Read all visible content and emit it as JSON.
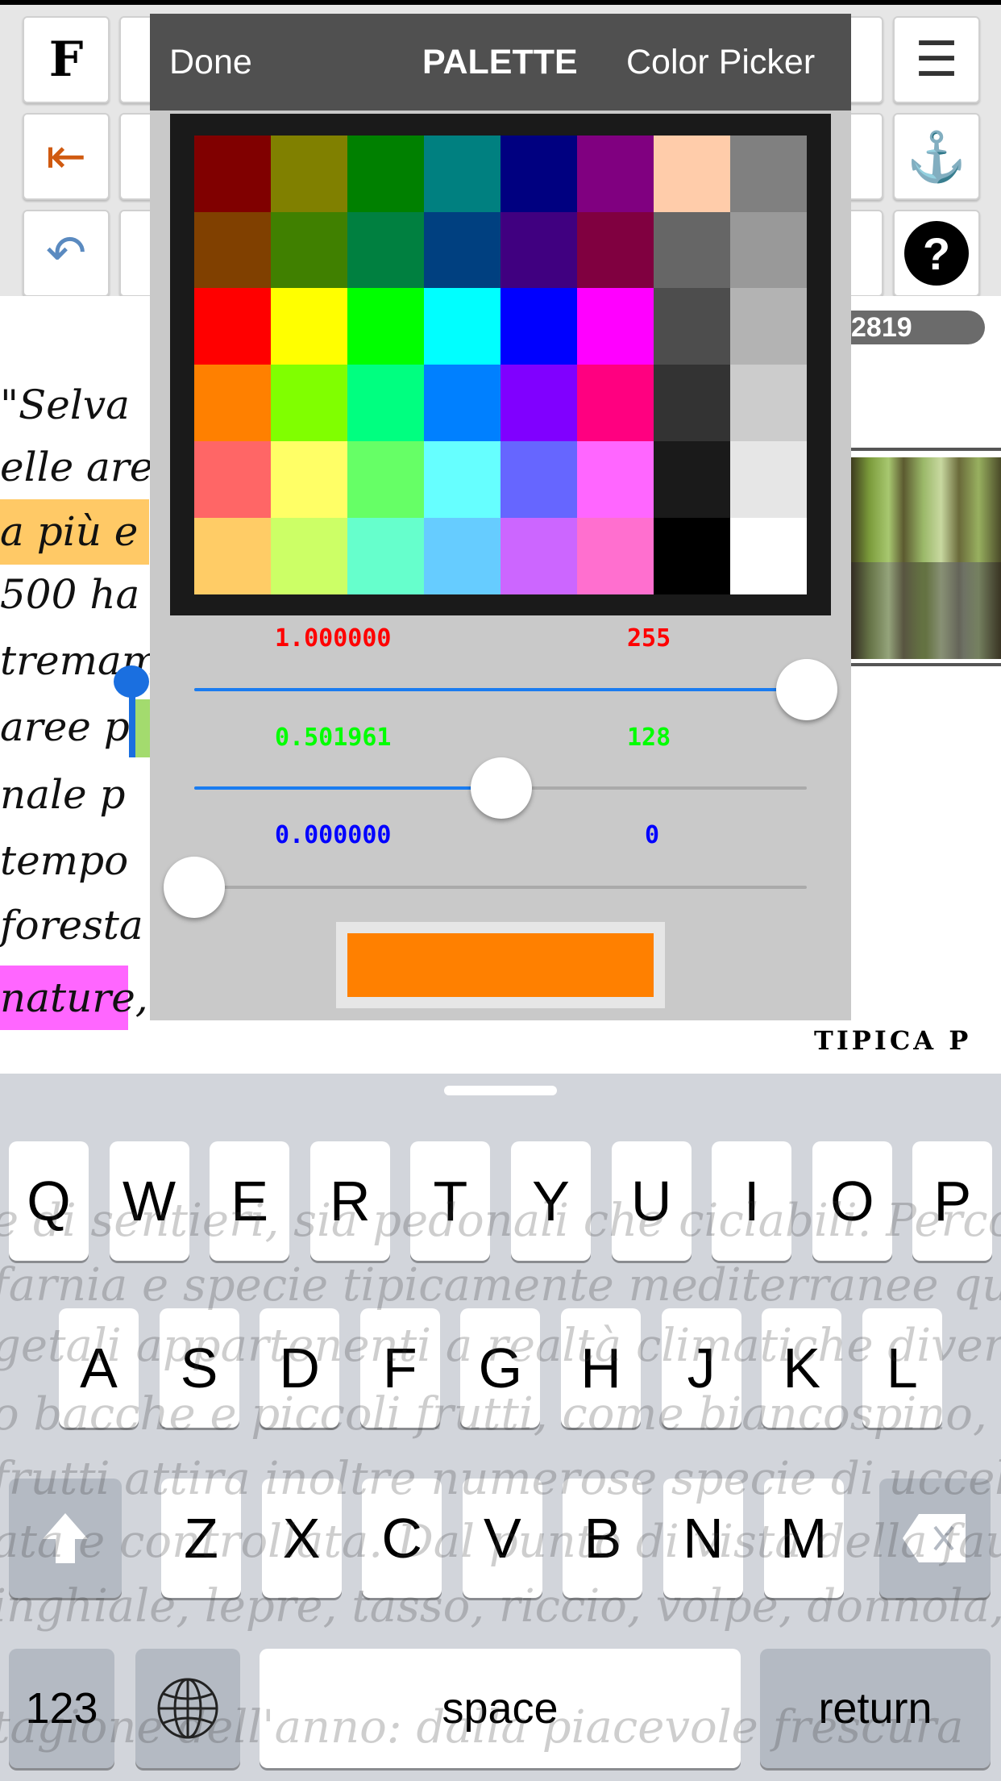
{
  "toolbar": {
    "icons": [
      "bold-f-icon",
      "outdent-icon",
      "undo-icon",
      "align-justify-icon",
      "anchor-icon",
      "help-icon"
    ],
    "bold_label": "F",
    "help_label": "?"
  },
  "document": {
    "lines": [
      "\"Selva",
      "elle are",
      "a più e",
      "500 ha",
      "tremam",
      "aree p",
      "nale p",
      "tempo",
      "foresta",
      "nature,"
    ],
    "highlight_orange": "#ffc966",
    "highlight_green": "#a3db6e",
    "highlight_pink": "#ff66ff",
    "badge": "2819",
    "caption": "TIPICA P"
  },
  "popup": {
    "done": "Done",
    "tab_palette": "PALETTE",
    "tab_picker": "Color Picker",
    "palette": [
      [
        "#800000",
        "#808000",
        "#008000",
        "#008080",
        "#000080",
        "#800080",
        "#ffcc aa",
        "#808080"
      ],
      [
        "#804000",
        "#408000",
        "#008040",
        "#004080",
        "#400080",
        "#800040",
        "#666666",
        "#999999"
      ],
      [
        "#ff0000",
        "#ffff00",
        "#00ff00",
        "#00ffff",
        "#0000ff",
        "#ff00ff",
        "#4d4d4d",
        "#b3b3b3"
      ],
      [
        "#ff8000",
        "#80ff00",
        "#00ff80",
        "#0080ff",
        "#8000ff",
        "#ff0080",
        "#333333",
        "#cccccc"
      ],
      [
        "#ff6666",
        "#ffff66",
        "#66ff66",
        "#66ffff",
        "#6666ff",
        "#ff66ff",
        "#1a1a1a",
        "#e6e6e6"
      ],
      [
        "#ffcc66",
        "#ccff66",
        "#66ffcc",
        "#66ccff",
        "#cc66ff",
        "#ff6fcf",
        "#000000",
        "#ffffff"
      ]
    ],
    "red": {
      "fraction": "1.000000",
      "value": "255",
      "level": 1.0,
      "color": "#ff0000"
    },
    "green": {
      "fraction": "0.501961",
      "value": "128",
      "level": 0.501961,
      "color": "#00ff00"
    },
    "blue": {
      "fraction": "0.000000",
      "value": "0",
      "level": 0.0,
      "color": "#0000ff"
    },
    "selected_color": "#ff8000"
  },
  "keyboard": {
    "row1": [
      "Q",
      "W",
      "E",
      "R",
      "T",
      "Y",
      "U",
      "I",
      "O",
      "P"
    ],
    "row2": [
      "A",
      "S",
      "D",
      "F",
      "G",
      "H",
      "J",
      "K",
      "L"
    ],
    "row3": [
      "Z",
      "X",
      "C",
      "V",
      "B",
      "N",
      "M"
    ],
    "numbers": "123",
    "space": "space",
    "return": "return",
    "ghost_lines": [
      "e di sentieri, sia pedonali che ciclabili. Percorren",
      "farnia e specie tipicamente mediterranee qual",
      "getali appartenenti a realtà climatiche diverse",
      "o bacche e piccoli frutti, come biancospino, pru",
      "frutti attira inoltre numerose specie di uccelli",
      "ata e controllata. Dal punto di vista della faun",
      "inghiale, lepre, tasso, riccio, volpe, donnola, ec",
      "tagione dell'anno: dalla piacevole frescura"
    ]
  }
}
